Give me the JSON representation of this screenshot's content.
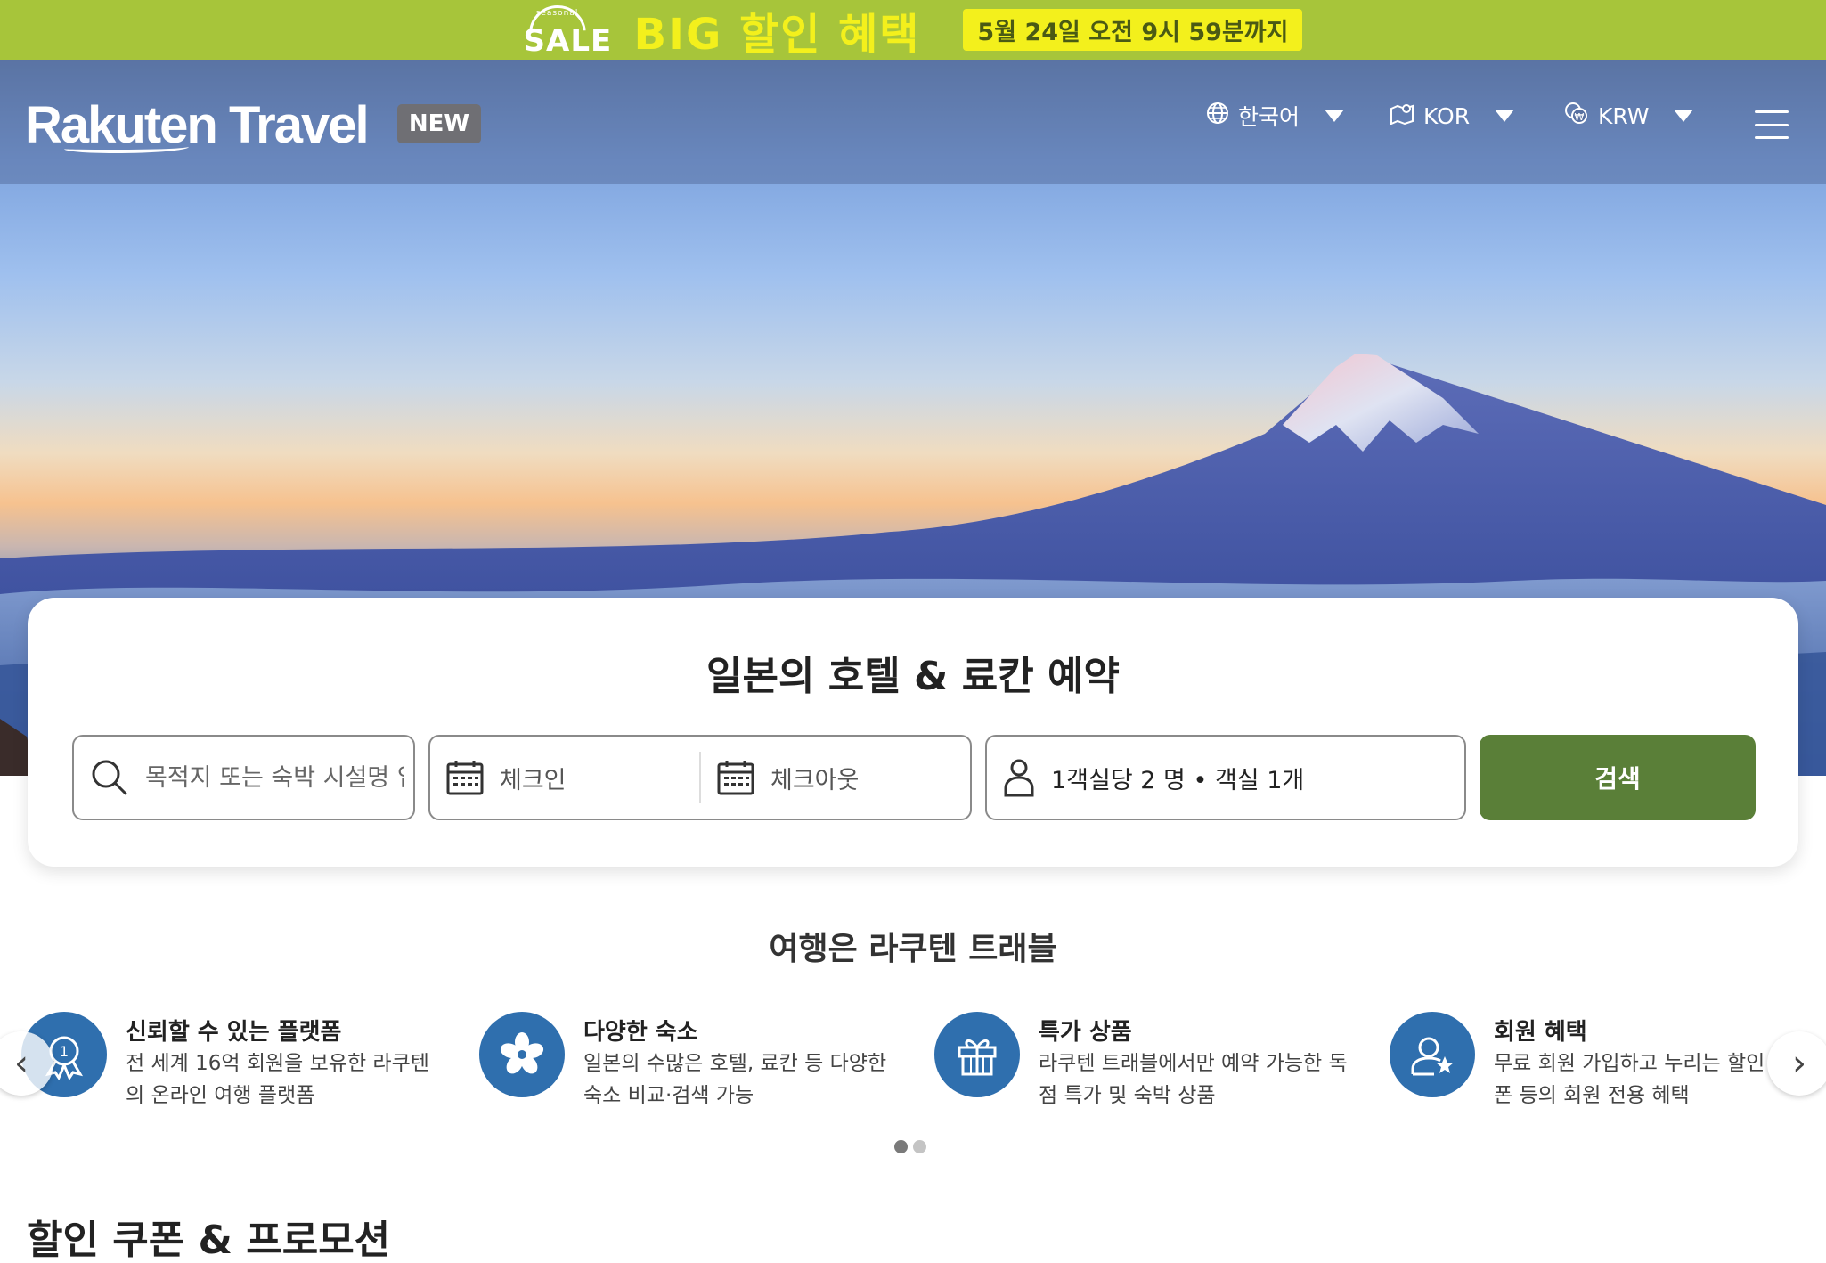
{
  "promo_banner": {
    "season_label": "seasonal",
    "sale_label": "SALE",
    "title": "BIG 할인 혜택",
    "deadline": "5월 24일 오전 9시 59분까지",
    "colors": {
      "background": "#a7c53a",
      "accent": "#f3f01c"
    }
  },
  "header": {
    "logo_text": "Rakuten Travel",
    "new_badge": "NEW",
    "language": "한국어",
    "region": "KOR",
    "currency": "KRW"
  },
  "search": {
    "title": "일본의 호텔 & 료칸 예약",
    "destination_placeholder": "목적지 또는 숙박 시설명 입력",
    "checkin_label": "체크인",
    "checkout_label": "체크아웃",
    "guests_label": "1객실당 2 명 • 객실 1개",
    "search_button": "검색",
    "colors": {
      "button": "#5a7f38"
    }
  },
  "features": {
    "title": "여행은 라쿠텐 트래블",
    "items": [
      {
        "title": "신뢰할 수 있는 플랫폼",
        "description": "전 세계 16억 회원을 보유한 라쿠텐의 온라인 여행 플랫폼",
        "icon": "award-icon"
      },
      {
        "title": "다양한 숙소",
        "description": "일본의 수많은 호텔, 료칸 등 다양한 숙소 비교·검색 가능",
        "icon": "flower-icon"
      },
      {
        "title": "특가 상품",
        "description": "라쿠텐 트래블에서만 예약 가능한 독점 특가 및 숙박 상품",
        "icon": "gift-icon"
      },
      {
        "title": "회원 혜택",
        "description": "무료 회원 가입하고 누리는 할인 쿠폰 등의 회원 전용 혜택",
        "icon": "member-star-icon"
      }
    ],
    "carousel_pages": 2,
    "active_page": 1,
    "colors": {
      "icon_circle": "#2f6fae"
    }
  },
  "promotions": {
    "title": "할인 쿠폰 & 프로모션"
  }
}
